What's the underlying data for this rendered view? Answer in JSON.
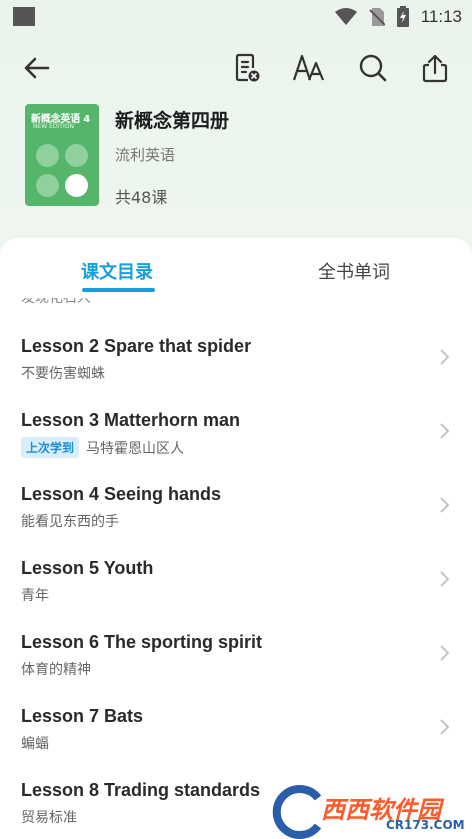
{
  "status_bar": {
    "time": "11:13"
  },
  "toolbar": {
    "back_icon": "arrow-left-icon",
    "note_icon": "note-icon",
    "font_icon": "font-size-icon",
    "search_icon": "search-icon",
    "share_icon": "share-icon"
  },
  "book": {
    "cover_title": "新概念英语 4",
    "cover_subtitle": "NEW EDITION",
    "title": "新概念第四册",
    "author": "流利英语",
    "lesson_count": "共48课"
  },
  "tabs": [
    {
      "label": "课文目录",
      "active": true
    },
    {
      "label": "全书单词",
      "active": false
    }
  ],
  "lessons": {
    "cutoff_text": "发现化石人",
    "items": [
      {
        "title": "Lesson 2 Spare that spider",
        "subtitle": "不要伤害蜘蛛"
      },
      {
        "title": "Lesson 3 Matterhorn man",
        "subtitle": "马特霍恩山区人",
        "badge": "上次学到"
      },
      {
        "title": "Lesson 4 Seeing hands",
        "subtitle": "能看见东西的手"
      },
      {
        "title": "Lesson 5 Youth",
        "subtitle": "青年"
      },
      {
        "title": "Lesson 6 The sporting spirit",
        "subtitle": "体育的精神"
      },
      {
        "title": "Lesson 7 Bats",
        "subtitle": "蝙蝠"
      },
      {
        "title": "Lesson 8 Trading standards",
        "subtitle": "贸易标准"
      }
    ]
  },
  "watermark": {
    "text": "西西软件园",
    "sub": "CR173.COM"
  },
  "colors": {
    "accent": "#1a9edb",
    "cover": "#55b66b",
    "badge_bg": "#d9eefc"
  }
}
